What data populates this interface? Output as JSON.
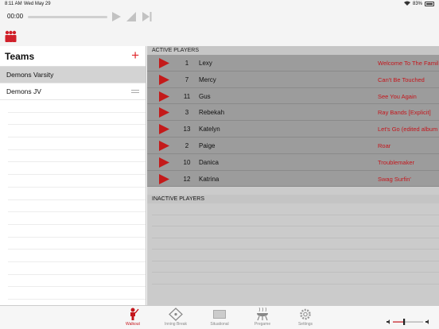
{
  "status_bar": {
    "time": "8:11 AM",
    "date": "Wed May 29",
    "battery": "83%"
  },
  "transport": {
    "elapsed": "00:00"
  },
  "sidebar": {
    "title": "Teams",
    "add_label": "+",
    "teams": [
      {
        "label": "Demons Varsity"
      },
      {
        "label": "Demons JV"
      }
    ]
  },
  "main": {
    "active_header": "ACTIVE PLAYERS",
    "inactive_header": "INACTIVE PLAYERS",
    "players": [
      {
        "number": "1",
        "name": "Lexy",
        "song": "Welcome To The Famil"
      },
      {
        "number": "7",
        "name": "Mercy",
        "song": "Can't Be Touched"
      },
      {
        "number": "11",
        "name": "Gus",
        "song": "See You Again"
      },
      {
        "number": "3",
        "name": "Rebekah",
        "song": "Ray Bands [Explicit]"
      },
      {
        "number": "13",
        "name": "Katelyn",
        "song": "Let's Go (edited album"
      },
      {
        "number": "2",
        "name": "Paige",
        "song": "Roar"
      },
      {
        "number": "10",
        "name": "Danica",
        "song": "Troublemaker"
      },
      {
        "number": "12",
        "name": "Katrina",
        "song": "Swag Surfin'"
      }
    ]
  },
  "tabs": [
    {
      "label": "Walkout",
      "icon": "walkout-icon",
      "active": true
    },
    {
      "label": "Inning Break",
      "icon": "inning-break-icon",
      "active": false
    },
    {
      "label": "Situational",
      "icon": "situational-icon",
      "active": false
    },
    {
      "label": "Pregame",
      "icon": "pregame-icon",
      "active": false
    },
    {
      "label": "Settings",
      "icon": "settings-icon",
      "active": false
    }
  ],
  "colors": {
    "accent": "#c4161c",
    "play": "#c41a1a"
  }
}
